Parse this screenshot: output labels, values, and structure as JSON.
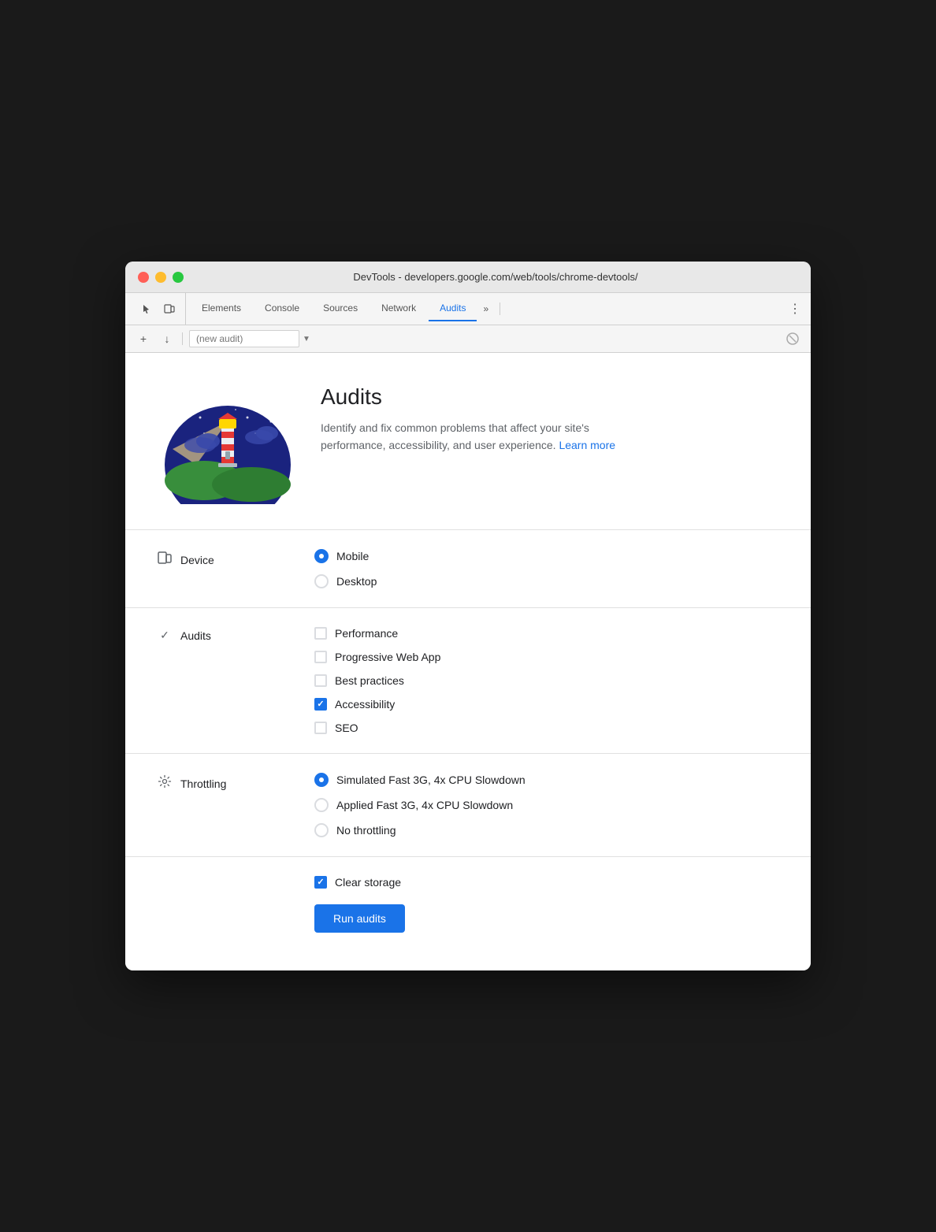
{
  "window": {
    "title": "DevTools - developers.google.com/web/tools/chrome-devtools/"
  },
  "tabs": {
    "items": [
      {
        "label": "Elements",
        "active": false
      },
      {
        "label": "Console",
        "active": false
      },
      {
        "label": "Sources",
        "active": false
      },
      {
        "label": "Network",
        "active": false
      },
      {
        "label": "Audits",
        "active": true
      }
    ],
    "more_label": "»",
    "menu_label": "⋮"
  },
  "toolbar": {
    "add_label": "+",
    "download_label": "↓",
    "select_value": "(new audit)",
    "stop_label": "🚫"
  },
  "hero": {
    "title": "Audits",
    "description": "Identify and fix common problems that affect your site's performance, accessibility, and user experience.",
    "learn_more": "Learn more"
  },
  "device": {
    "label": "Device",
    "options": [
      {
        "label": "Mobile",
        "selected": true
      },
      {
        "label": "Desktop",
        "selected": false
      }
    ]
  },
  "audits": {
    "label": "Audits",
    "options": [
      {
        "label": "Performance",
        "checked": false
      },
      {
        "label": "Progressive Web App",
        "checked": false
      },
      {
        "label": "Best practices",
        "checked": false
      },
      {
        "label": "Accessibility",
        "checked": true
      },
      {
        "label": "SEO",
        "checked": false
      }
    ]
  },
  "throttling": {
    "label": "Throttling",
    "options": [
      {
        "label": "Simulated Fast 3G, 4x CPU Slowdown",
        "selected": true
      },
      {
        "label": "Applied Fast 3G, 4x CPU Slowdown",
        "selected": false
      },
      {
        "label": "No throttling",
        "selected": false
      }
    ]
  },
  "clear_storage": {
    "label": "Clear storage",
    "checked": true
  },
  "run_button": {
    "label": "Run audits"
  }
}
